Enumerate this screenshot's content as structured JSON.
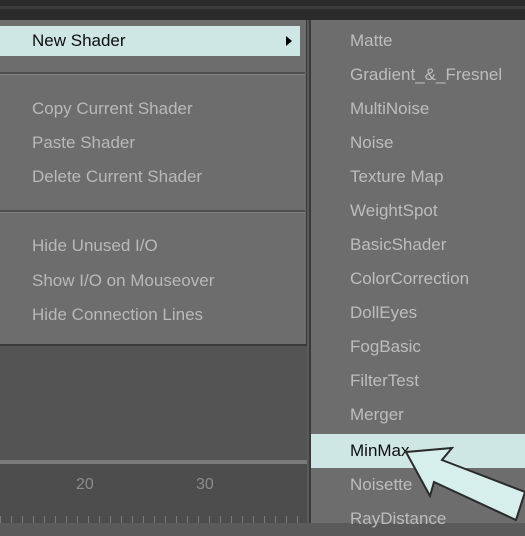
{
  "menu": {
    "items": [
      {
        "label": "New Shader",
        "active": true,
        "submenu": true
      },
      {
        "label": "Copy Current Shader"
      },
      {
        "label": "Paste Shader"
      },
      {
        "label": "Delete Current Shader"
      },
      {
        "label": "Hide Unused I/O"
      },
      {
        "label": "Show I/O on Mouseover"
      },
      {
        "label": "Hide Connection Lines"
      }
    ]
  },
  "ruler": {
    "labels": [
      "20",
      "30"
    ]
  },
  "submenu": {
    "items": [
      {
        "label": "Matte"
      },
      {
        "label": "Gradient_&_Fresnel"
      },
      {
        "label": "MultiNoise"
      },
      {
        "label": "Noise"
      },
      {
        "label": "Texture Map"
      },
      {
        "label": "WeightSpot"
      },
      {
        "label": "BasicShader"
      },
      {
        "label": "ColorCorrection"
      },
      {
        "label": "DollEyes"
      },
      {
        "label": "FogBasic"
      },
      {
        "label": "FilterTest"
      },
      {
        "label": "Merger"
      },
      {
        "label": "MinMax",
        "active": true
      },
      {
        "label": "Noisette"
      },
      {
        "label": "RayDistance"
      }
    ]
  },
  "colors": {
    "highlight": "#cfe7e4",
    "menu_bg": "#6d6d6d",
    "text_disabled": "#b9b9b9"
  },
  "icons": {
    "submenu_arrow": "triangle-right-icon",
    "pointer": "arrow-pointer-icon"
  }
}
